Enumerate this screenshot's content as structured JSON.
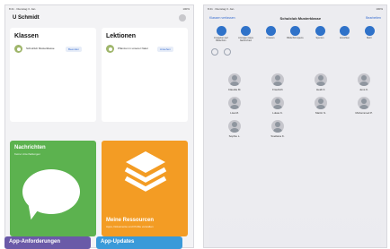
{
  "left": {
    "status": {
      "left": "8:41 · Dienstag 3. Jan.",
      "right": "100%"
    },
    "title": "U Schmidt",
    "cards": [
      {
        "title": "Klassen",
        "item": {
          "name": "Schulclub Musterklasse",
          "action": "Beenden"
        }
      },
      {
        "title": "Lektionen",
        "item": {
          "name": "Pflanzen in unserer Natur",
          "action": "Ansehen"
        }
      }
    ],
    "tiles": [
      {
        "title": "Nachrichten",
        "sub": "Keine Unterhaltungen",
        "color": "#5cb24f"
      },
      {
        "title": "Meine Ressourcen",
        "sub": "Apps, Dokumente und Profile verwalten",
        "color": "#f39c24"
      }
    ],
    "bottom_tiles": [
      {
        "title": "App-Anforderungen",
        "color": "#6a5aa8"
      },
      {
        "title": "App-Updates",
        "color": "#3a9ad9"
      }
    ]
  },
  "right": {
    "status": {
      "left": "8:41 · Dienstag 3. Jan.",
      "right": "100%"
    },
    "back_label": "Klassen verfassen",
    "title": "Schulclub Musterklasse",
    "edit_label": "Bearbeiten",
    "tools": [
      {
        "label": "Freigeben auf Bildschirm",
        "icon": "screen-icon"
      },
      {
        "label": "Anzeigen Apps Nachrichten",
        "icon": "apps-icon"
      },
      {
        "label": "Fixieren",
        "icon": "lock-icon"
      },
      {
        "label": "Bildschirmsperre",
        "icon": "screen-lock-icon"
      },
      {
        "label": "Sperren",
        "icon": "padlock-icon"
      },
      {
        "label": "Ansichten",
        "icon": "view-icon"
      },
      {
        "label": "Mehr",
        "icon": "more-icon"
      }
    ],
    "students": [
      "Claudia M.",
      "Friedrich",
      "Heidi F.",
      "Jens K.",
      "Lisa M.",
      "Lukas K.",
      "Martin S.",
      "Mohammed P.",
      "Sophie L.",
      "Svetlana K."
    ]
  }
}
